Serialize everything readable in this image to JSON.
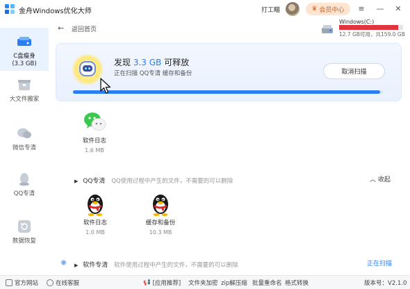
{
  "titlebar": {
    "app_title": "金舟Windows优化大师",
    "username": "打工瞄",
    "vip_label": "会员中心",
    "vip_icon": "crown-icon"
  },
  "sidebar": {
    "items": [
      {
        "label_line1": "C盘瘦身",
        "label_line2": "(3.3 GB)",
        "icon": "disk-icon",
        "active": true
      },
      {
        "label": "大文件搬家",
        "icon": "box-icon"
      },
      {
        "label": "微信专清",
        "icon": "wechat-icon"
      },
      {
        "label": "QQ专清",
        "icon": "qq-icon"
      },
      {
        "label": "数据恢复",
        "icon": "recover-icon"
      }
    ]
  },
  "header": {
    "back_label": "返回首页",
    "drive_name": "Windows(C:)",
    "drive_free": "12.7 GB可用，共159.0 GB",
    "drive_used_fraction": 0.92,
    "drive_bar_color": "#e0353f"
  },
  "scan": {
    "title_prefix": "发现",
    "title_size": "3.3 GB",
    "title_suffix": "可释放",
    "subtitle": "正在扫描 QQ专清 缓存和备份",
    "cancel_label": "取消扫描",
    "progress_fraction": 0.99,
    "accent_color": "#2a7df2"
  },
  "wechat_section": {
    "items": [
      {
        "name": "软件日志",
        "size": "1.6 MB",
        "icon": "wechat-icon"
      }
    ]
  },
  "qq_section": {
    "title": "QQ专清",
    "desc": "QQ使用过程中产生的文件，不需要的可以删除",
    "collapse_label": "收起",
    "items": [
      {
        "name": "软件日志",
        "size": "1.0 MB",
        "icon": "qq-penguin-icon"
      },
      {
        "name": "缓存和备份",
        "size": "10.3 MB",
        "icon": "qq-penguin-icon"
      }
    ]
  },
  "software_section": {
    "title": "软件专清",
    "desc": "软件使用过程中产生的文件，不需要的可以删除",
    "status": "正在扫描"
  },
  "footer": {
    "official_site": "官方网站",
    "online_service": "在线客服",
    "recommend": "[应用推荐]",
    "tools": [
      "文件夹加密",
      "zip解压缩",
      "批量重命名",
      "格式转换"
    ],
    "version": "版本号：V2.1.0"
  }
}
